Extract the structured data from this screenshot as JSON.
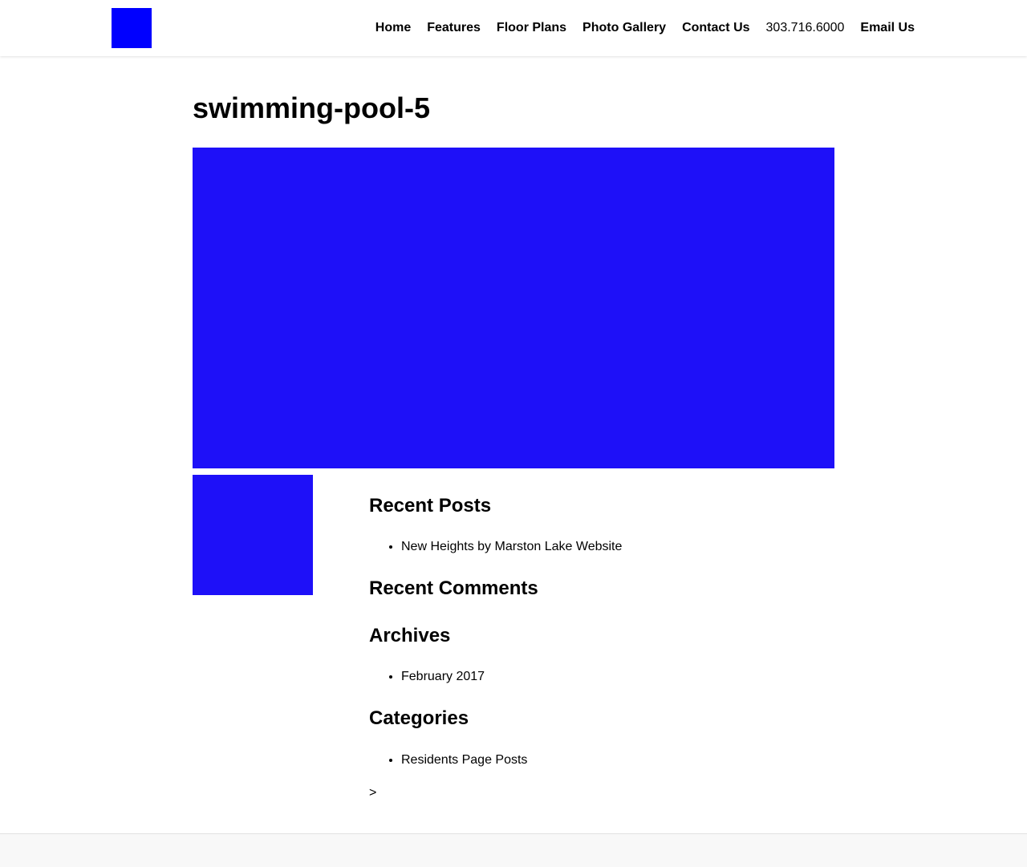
{
  "colors": {
    "logo": "#0000ff",
    "image_fill": "#1e10f8",
    "footer_bg": "#f8f8f8",
    "text": "#000000"
  },
  "header": {
    "logo_alt": "Marston Lake logo",
    "nav": {
      "home": "Home",
      "features": "Features",
      "floor_plans": "Floor Plans",
      "photo_gallery": "Photo Gallery",
      "contact_us": "Contact Us",
      "phone": "303.716.6000",
      "email_us": "Email Us"
    }
  },
  "main": {
    "title": "swimming-pool-5"
  },
  "sidebar": {
    "recent_posts": {
      "title": "Recent Posts",
      "items": [
        "New Heights by Marston Lake Website"
      ]
    },
    "recent_comments": {
      "title": "Recent Comments"
    },
    "archives": {
      "title": "Archives",
      "items": [
        "February 2017"
      ]
    },
    "categories": {
      "title": "Categories",
      "items": [
        "Residents Page Posts"
      ]
    },
    "stray_text": ">"
  }
}
